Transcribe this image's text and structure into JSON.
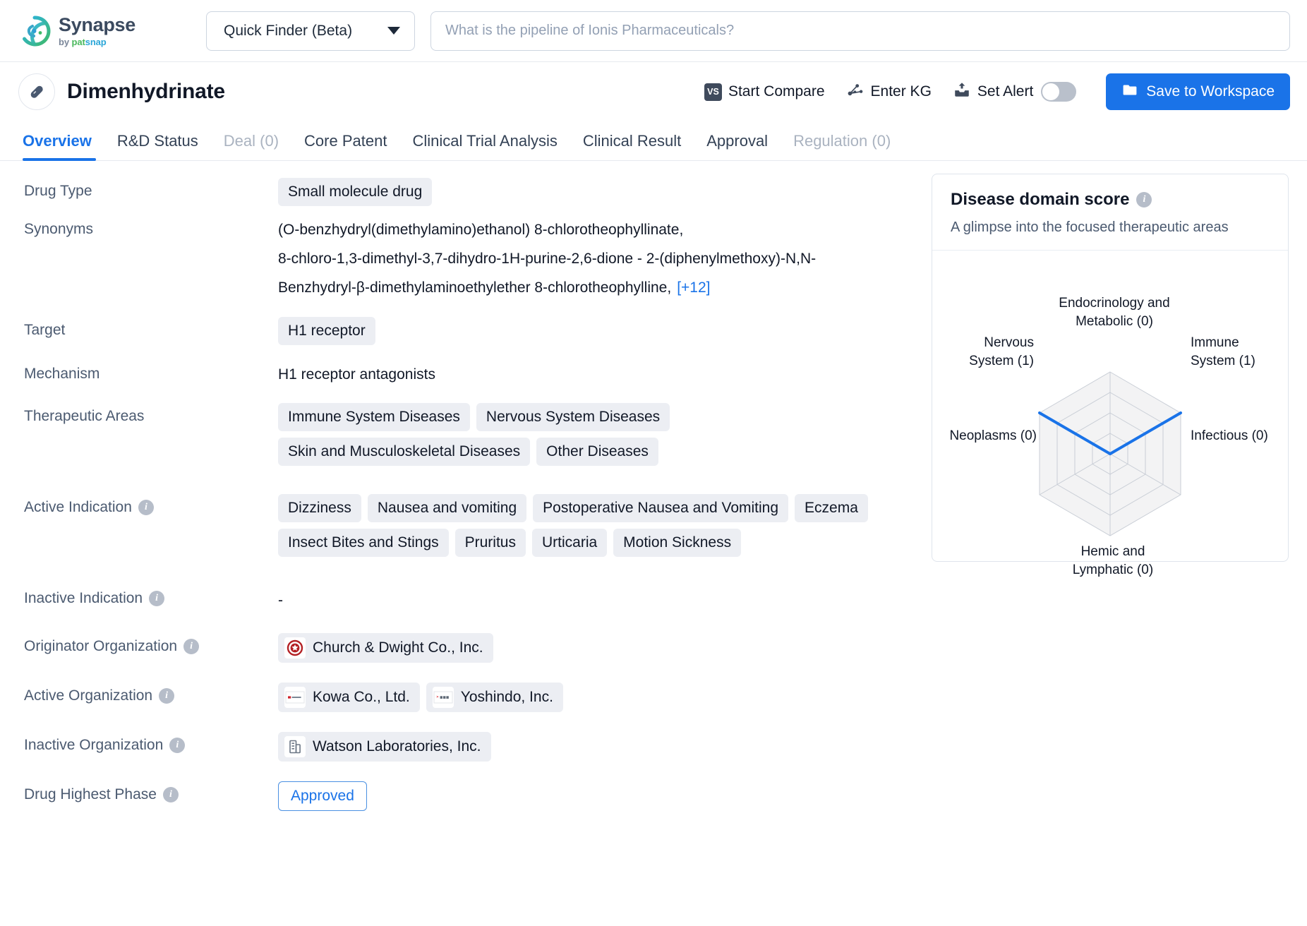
{
  "brand": {
    "name": "Synapse",
    "by": "by ",
    "pat": "pat",
    "snap": "snap",
    "logo_icon": "synapse-logo-icon"
  },
  "topbar": {
    "finder_label": "Quick Finder (Beta)",
    "finder_caret_icon": "chevron-down-icon",
    "search_placeholder": "What is the pipeline of Ionis Pharmaceuticals?",
    "search_value": ""
  },
  "drug_header": {
    "icon": "pill-icon",
    "title": "Dimenhydrinate",
    "actions": [
      {
        "label": "Start Compare",
        "icon": "vs-icon",
        "badge": "VS"
      },
      {
        "label": "Enter KG",
        "icon": "knowledge-graph-icon"
      },
      {
        "label": "Set Alert",
        "icon": "alert-inbox-icon"
      }
    ],
    "alert_toggle_state": "off",
    "save_label": "Save to Workspace",
    "save_icon": "folder-icon",
    "accent_color": "#1a73e8"
  },
  "tabs": [
    {
      "label": "Overview",
      "state": "active"
    },
    {
      "label": "R&D Status",
      "state": "normal"
    },
    {
      "label": "Deal (0)",
      "state": "disabled"
    },
    {
      "label": "Core Patent",
      "state": "normal"
    },
    {
      "label": "Clinical Trial Analysis",
      "state": "normal"
    },
    {
      "label": "Clinical Result",
      "state": "normal"
    },
    {
      "label": "Approval",
      "state": "normal"
    },
    {
      "label": "Regulation (0)",
      "state": "disabled"
    }
  ],
  "fields": {
    "drug_type": {
      "label": "Drug Type",
      "values": [
        "Small molecule drug"
      ]
    },
    "synonyms": {
      "label": "Synonyms",
      "line1": "(O-benzhydryl(dimethylamino)ethanol) 8-chlorotheophyllinate,",
      "line2": "8-chloro-1,3-dimethyl-3,7-dihydro-1H-purine-2,6-dione - 2-(diphenylmethoxy)-N,N-",
      "line3": "Benzhydryl-β-dimethylaminoethylether 8-chlorotheophylline,",
      "more": "[+12]"
    },
    "target": {
      "label": "Target",
      "values": [
        "H1 receptor"
      ]
    },
    "mechanism": {
      "label": "Mechanism",
      "value": "H1 receptor antagonists"
    },
    "therapeutic_areas": {
      "label": "Therapeutic Areas",
      "values": [
        "Immune System Diseases",
        "Nervous System Diseases",
        "Skin and Musculoskeletal Diseases",
        "Other Diseases"
      ]
    },
    "active_indication": {
      "label": "Active Indication",
      "info_icon": "info-icon",
      "values": [
        "Dizziness",
        "Nausea and vomiting",
        "Postoperative Nausea and Vomiting",
        "Eczema",
        "Insect Bites and Stings",
        "Pruritus",
        "Urticaria",
        "Motion Sickness"
      ]
    },
    "inactive_indication": {
      "label": "Inactive Indication",
      "info_icon": "info-icon",
      "value": "-"
    },
    "originator_organization": {
      "label": "Originator Organization",
      "info_icon": "info-icon",
      "values": [
        {
          "name": "Church & Dwight Co., Inc.",
          "logo": "church-dwight-logo"
        }
      ]
    },
    "active_organization": {
      "label": "Active Organization",
      "info_icon": "info-icon",
      "values": [
        {
          "name": "Kowa Co., Ltd.",
          "logo": "kowa-logo"
        },
        {
          "name": "Yoshindo, Inc.",
          "logo": "yoshindo-logo"
        }
      ]
    },
    "inactive_organization": {
      "label": "Inactive Organization",
      "info_icon": "info-icon",
      "values": [
        {
          "name": "Watson Laboratories, Inc.",
          "logo": "building-icon"
        }
      ]
    },
    "drug_highest_phase": {
      "label": "Drug Highest Phase",
      "info_icon": "info-icon",
      "value": "Approved"
    }
  },
  "score_panel": {
    "title": "Disease domain score",
    "info_icon": "info-icon",
    "subtitle": "A glimpse into the focused therapeutic areas"
  },
  "chart_data": {
    "type": "radar",
    "title": "Disease domain score",
    "subtitle": "A glimpse into the focused therapeutic areas",
    "categories": [
      "Endocrinology and Metabolic (0)",
      "Immune System (1)",
      "Infectious (0)",
      "Hemic and Lymphatic (0)",
      "Neoplasms (0)",
      "Nervous System (1)"
    ],
    "category_labels_line1": [
      "Endocrinology and",
      "Immune",
      "Infectious (0)",
      "Hemic and",
      "Neoplasms (0)",
      "Nervous"
    ],
    "category_labels_line2": [
      "Metabolic (0)",
      "System (1)",
      "",
      "Lymphatic (0)",
      "",
      "System (1)"
    ],
    "values": [
      0,
      1,
      0,
      0,
      0,
      1
    ],
    "rmax": 1,
    "rings": 4,
    "grid": true,
    "legend": "none",
    "series_color": "#1a73e8",
    "grid_color": "#c9ced6",
    "fill_color": "#f2f3f5"
  }
}
